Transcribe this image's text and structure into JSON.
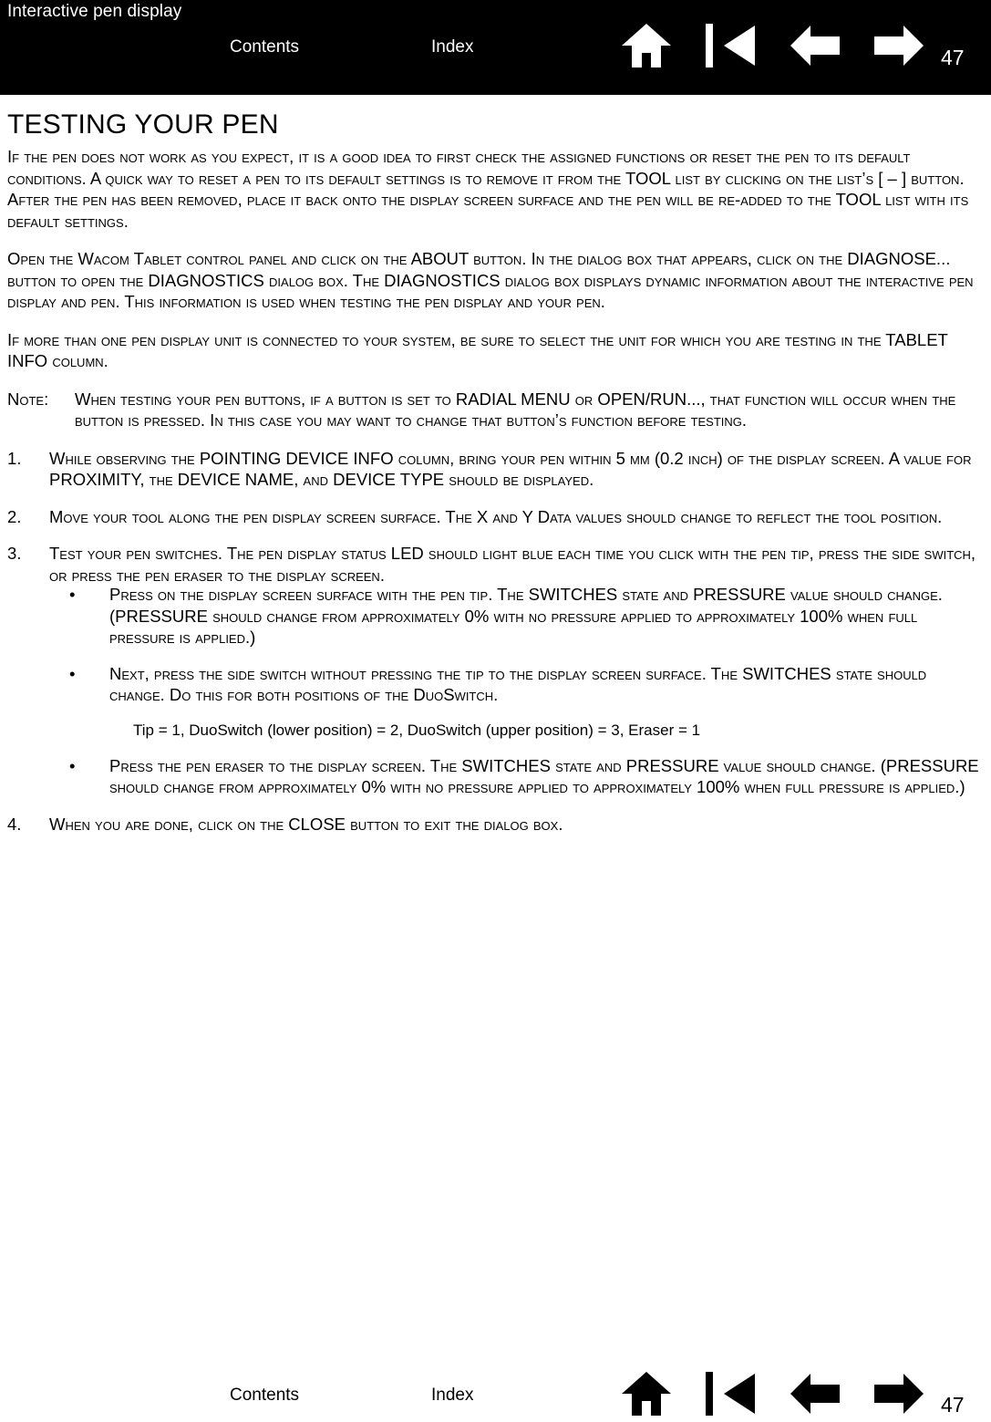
{
  "header": {
    "title": "Interactive pen display",
    "contents_label": "Contents",
    "index_label": "Index",
    "page_number": "47",
    "icons": [
      "home-icon",
      "back-to-top-icon",
      "previous-page-icon",
      "next-page-icon"
    ]
  },
  "main": {
    "heading": "TESTING YOUR PEN",
    "paragraphs": [
      "If the pen does not work as you expect, it is a good idea to first check the assigned functions or reset the pen to its default conditions.  A quick way to reset a pen to its default settings is to remove it from the TOOL list by clicking on the list’s [ – ] button.  After the pen has been removed, place it back onto the display screen surface and the pen will be re-added to the TOOL list with its default settings.",
      "Open the Wacom Tablet control panel and click on the ABOUT button.  In the dialog box that appears, click on the DIAGNOSE... button to open the DIAGNOSTICS dialog box.  The DIAGNOSTICS dialog box displays dynamic information about the interactive pen display and pen.  This information is used when testing the pen display and your pen.",
      "If more than one pen display unit is connected to your system, be sure to select the unit for which you are testing in the TABLET INFO column."
    ],
    "note": {
      "label": "Note:",
      "text": "When testing your pen buttons, if a button is set to RADIAL MENU or OPEN/RUN..., that function will occur when the button is pressed.  In this case you may want to change that button’s function before testing."
    },
    "steps": [
      {
        "num": "1.",
        "text": "While observing the POINTING DEVICE INFO column, bring your pen within 5 mm (0.2 inch) of the display screen.  A value for PROXIMITY, the DEVICE NAME, and DEVICE TYPE should be displayed."
      },
      {
        "num": "2.",
        "text": "Move your tool along the pen display screen surface.  The X and Y Data values should change to reflect the tool position."
      },
      {
        "num": "3.",
        "text": "Test your pen switches.  The pen display status LED should light blue each time you click with the pen tip, press the side switch, or press the pen eraser to the display screen."
      },
      {
        "num": "4.",
        "text": "When you are done, click on the CLOSE button to exit the dialog box."
      }
    ],
    "bullets": [
      "Press on the display screen surface with the pen tip.  The SWITCHES state and PRESSURE value should change.  (PRESSURE should change from approximately 0% with no pressure applied to approximately 100% when full pressure is applied.)",
      "Next, press the side switch without pressing the tip to the display screen surface.  The SWITCHES state should change.  Do this for both positions of the DuoSwitch.",
      "Press the pen eraser to the display screen.  The SWITCHES state and PRESSURE value should change.  (PRESSURE should change from approximately 0% with no pressure applied to approximately 100% when full pressure is applied.)"
    ],
    "switch_values_line": "Tip = 1, DuoSwitch (lower position) = 2, DuoSwitch (upper position) = 3, Eraser = 1"
  },
  "footer": {
    "contents_label": "Contents",
    "index_label": "Index",
    "page_number": "47",
    "icons": [
      "home-icon",
      "back-to-top-icon",
      "previous-page-icon",
      "next-page-icon"
    ]
  },
  "colors": {
    "header_bg": "#000000",
    "header_text": "#ffffff",
    "body_text": "#000000",
    "page_bg": "#ffffff"
  }
}
